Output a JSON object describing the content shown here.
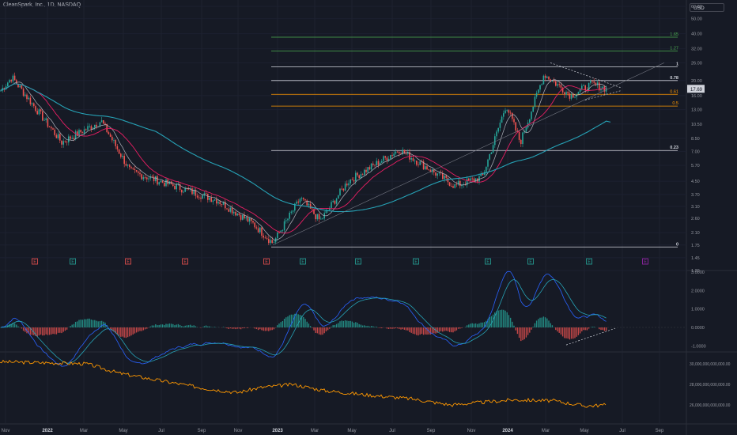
{
  "header": {
    "symbol": "CleanSpark, Inc., 1D, NASDAQ",
    "currency": "USD"
  },
  "price_axis": {
    "ticks": [
      "60.00",
      "50.00",
      "40.00",
      "32.00",
      "26.00",
      "20.00",
      "16.00",
      "13.00",
      "10.50",
      "8.50",
      "7.00",
      "5.70",
      "4.50",
      "3.70",
      "3.10",
      "2.60",
      "2.10",
      "1.75",
      "1.45",
      "1.20"
    ],
    "last_price": "17.69"
  },
  "fib_levels": [
    {
      "label": "1.65",
      "color": "#4caf50"
    },
    {
      "label": "1.27",
      "color": "#4caf50"
    },
    {
      "label": "1",
      "color": "#d1d4dc"
    },
    {
      "label": "0.78",
      "color": "#d1d4dc"
    },
    {
      "label": "0.61",
      "color": "#ff9800"
    },
    {
      "label": "0.5",
      "color": "#ff9800"
    },
    {
      "label": "0.23",
      "color": "#d1d4dc"
    },
    {
      "label": "0",
      "color": "#d1d4dc"
    }
  ],
  "macd_axis": {
    "ticks": [
      "3.0000",
      "2.0000",
      "1.0000",
      "0.0000",
      "-1.0000"
    ]
  },
  "supply_axis": {
    "ticks": [
      "30,000,000,000,000.00",
      "28,000,000,000,000.00",
      "26,000,000,000,000.00"
    ]
  },
  "time_axis": {
    "ticks": [
      "Nov",
      "2022",
      "Mar",
      "May",
      "Jul",
      "Sep",
      "Nov",
      "2023",
      "Mar",
      "May",
      "Jul",
      "Sep",
      "Nov",
      "2024",
      "Mar",
      "May",
      "Jul",
      "Sep"
    ]
  },
  "event_markers": [
    "E",
    "E",
    "E",
    "E",
    "E",
    "E",
    "E",
    "E",
    "E",
    "E",
    "E",
    "E"
  ],
  "colors": {
    "up": "#26a69a",
    "down": "#ef5350",
    "ma_fast": "#b2b5be",
    "ma_mid": "#e91e63",
    "ma_slow": "#26a2b6",
    "supply": "#ff9800",
    "macd": "#2962ff"
  },
  "chart_data": {
    "type": "line",
    "price_scale": "log",
    "series": [
      {
        "name": "",
        "x": [
          "2021-10",
          "2021-11",
          "2022-01",
          "2022-03",
          "2022-05",
          "2022-07",
          "2022-09",
          "2022-11",
          "2022-12",
          "2023-02",
          "2023-04",
          "2023-05",
          "2023-07",
          "2023-09",
          "2023-11",
          "2023-12",
          "2024-01",
          "2024-03",
          "2024-04",
          "2024-05",
          "2024-06"
        ],
        "values": [
          17,
          21,
          8,
          11,
          5.2,
          4.2,
          3.4,
          2.4,
          1.8,
          3.5,
          2.5,
          4.5,
          7.2,
          4.2,
          4.8,
          14,
          8,
          22,
          16,
          19,
          17.69
        ]
      }
    ],
    "fib_prices": [
      38,
      31,
      24.5,
      20,
      16.3,
      13.7,
      7.1,
      1.7
    ],
    "ylim": [
      1.2,
      60
    ]
  }
}
